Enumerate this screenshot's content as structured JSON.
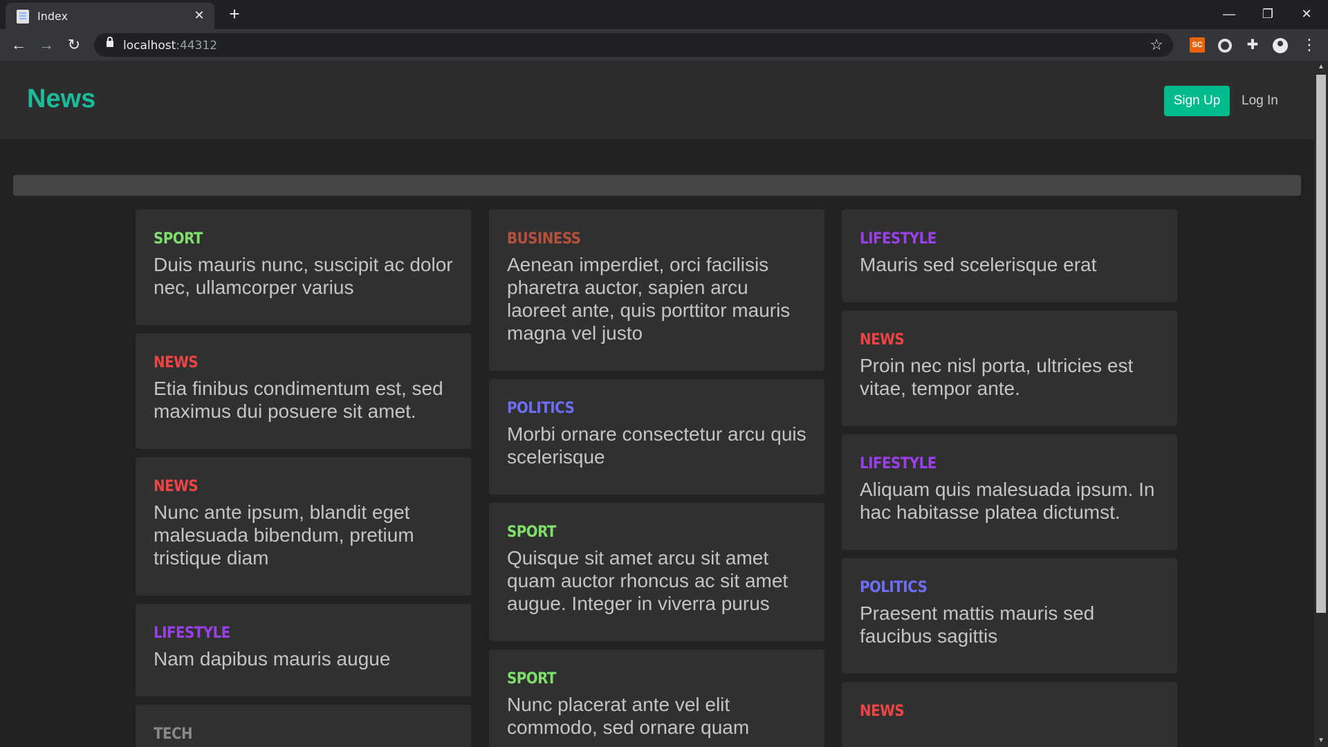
{
  "browser": {
    "tab_title": "Index",
    "url_host": "localhost",
    "url_port": ":44312",
    "extension_sc_label": "SC"
  },
  "navbar": {
    "brand": "News",
    "signup_label": "Sign Up",
    "login_label": "Log In"
  },
  "colors": {
    "accent": "#00bc8c",
    "sport": "#7ee06a",
    "business": "#b5513b",
    "lifestyle": "#9b3fe8",
    "news": "#ef4444",
    "politics": "#6d6ef5",
    "tech": "#888888"
  },
  "columns": [
    [
      {
        "category": "SPORT",
        "category_key": "sport",
        "title": "Duis mauris nunc, suscipit ac dolor nec, ullamcorper varius"
      },
      {
        "category": "NEWS",
        "category_key": "news",
        "title": "Etia finibus condimentum est, sed maximus dui posuere sit amet."
      },
      {
        "category": "NEWS",
        "category_key": "news",
        "title": "Nunc ante ipsum, blandit eget malesuada bibendum, pretium tristique diam"
      },
      {
        "category": "LIFESTYLE",
        "category_key": "lifestyle",
        "title": "Nam dapibus mauris augue"
      },
      {
        "category": "TECH",
        "category_key": "tech",
        "title": ""
      }
    ],
    [
      {
        "category": "BUSINESS",
        "category_key": "business",
        "title": "Aenean imperdiet, orci facilisis pharetra auctor, sapien arcu laoreet ante, quis porttitor mauris magna vel justo"
      },
      {
        "category": "POLITICS",
        "category_key": "politics",
        "title": "Morbi ornare consectetur arcu quis scelerisque"
      },
      {
        "category": "SPORT",
        "category_key": "sport",
        "title": "Quisque sit amet arcu sit amet quam auctor rhoncus ac sit amet augue. Integer in viverra purus"
      },
      {
        "category": "SPORT",
        "category_key": "sport",
        "title": "Nunc placerat ante vel elit commodo, sed ornare quam"
      }
    ],
    [
      {
        "category": "LIFESTYLE",
        "category_key": "lifestyle",
        "title": "Mauris sed scelerisque erat"
      },
      {
        "category": "NEWS",
        "category_key": "news",
        "title": "Proin nec nisl porta, ultricies est vitae, tempor ante."
      },
      {
        "category": "LIFESTYLE",
        "category_key": "lifestyle",
        "title": "Aliquam quis malesuada ipsum. In hac habitasse platea dictumst."
      },
      {
        "category": "POLITICS",
        "category_key": "politics",
        "title": "Praesent mattis mauris sed faucibus sagittis"
      },
      {
        "category": "NEWS",
        "category_key": "news",
        "title": ""
      }
    ]
  ]
}
